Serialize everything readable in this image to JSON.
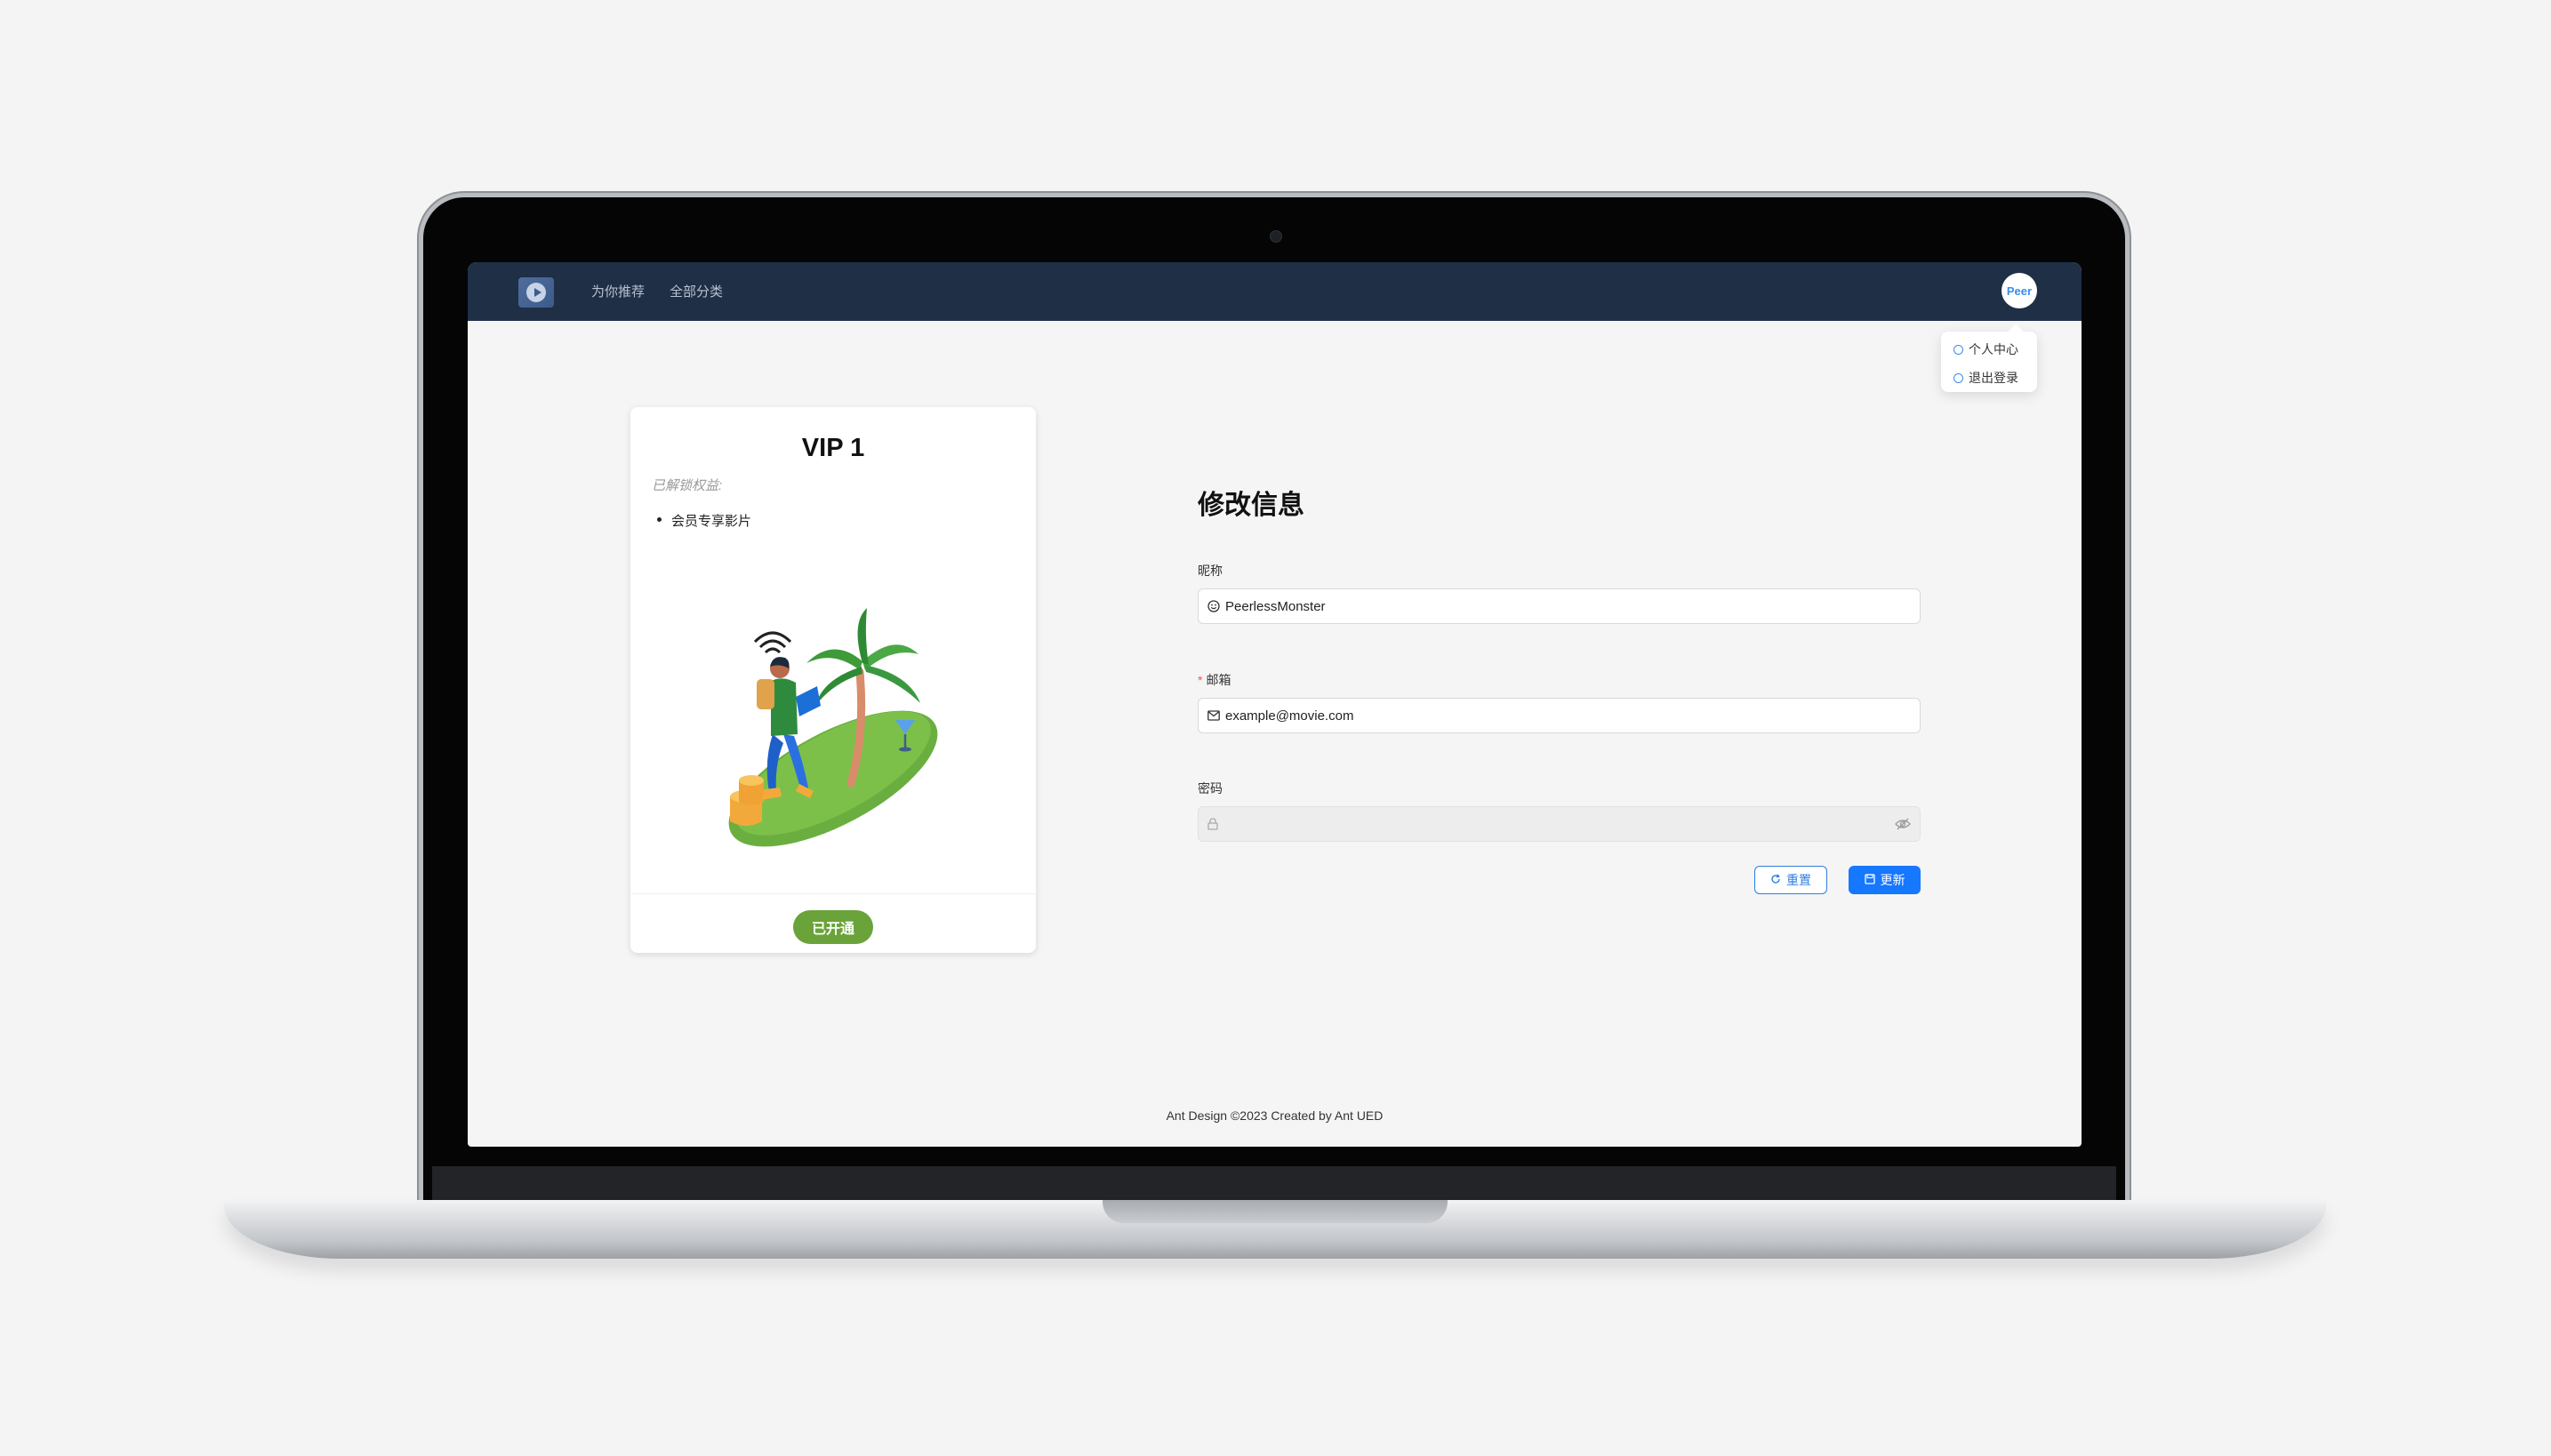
{
  "nav": {
    "logo_icon": "play-circle-icon",
    "items": [
      {
        "label": "为你推荐"
      },
      {
        "label": "全部分类"
      }
    ],
    "avatar_text": "Peer"
  },
  "user_menu": {
    "items": [
      {
        "label": "个人中心",
        "icon": "user-icon"
      },
      {
        "label": "退出登录",
        "icon": "logout-icon"
      }
    ]
  },
  "vip_card": {
    "title": "VIP 1",
    "subtitle": "已解锁权益:",
    "benefits": [
      "会员专享影片"
    ],
    "button_label": "已开通",
    "button_color": "#6aa33a"
  },
  "form": {
    "title": "修改信息",
    "nickname": {
      "label": "昵称",
      "value": "PeerlessMonster",
      "icon": "smile-icon"
    },
    "email": {
      "label": "邮箱",
      "required_mark": "*",
      "value": "example@movie.com",
      "icon": "mail-icon"
    },
    "password": {
      "label": "密码",
      "value": "",
      "icon": "lock-icon",
      "toggle_icon": "eye-invisible-icon"
    },
    "reset_label": "重置",
    "update_label": "更新"
  },
  "footer": {
    "text": "Ant Design ©2023 Created by Ant UED"
  },
  "colors": {
    "header_bg": "#1e2f46",
    "primary": "#1677ff",
    "vip_green": "#6aa33a"
  }
}
